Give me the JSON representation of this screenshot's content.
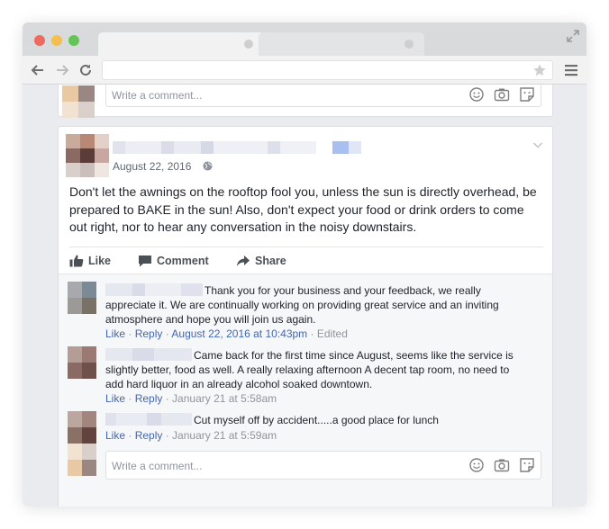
{
  "colors": {
    "link": "#4267b2",
    "meta": "#90949c",
    "text": "#1d2129",
    "page_bg": "#e9ebee"
  },
  "top_card": {
    "comment_placeholder": "Write a comment..."
  },
  "post": {
    "date": "August 22, 2016",
    "body": "Don't let the awnings on the rooftop fool you, unless the sun is directly overhead, be prepared to BAKE in the sun! Also, don't expect your food or drink orders to come out right, nor to hear any conversation in the noisy downstairs.",
    "actions": {
      "like": "Like",
      "comment": "Comment",
      "share": "Share"
    }
  },
  "comments": [
    {
      "text": "Thank you for your business and your feedback, we really appreciate it. We are continually working on providing great service and an inviting atmosphere and hope you will join us again.",
      "like": "Like",
      "reply": "Reply",
      "time": "August 22, 2016 at 10:43pm",
      "edited": "Edited"
    },
    {
      "text": "Came back for the first time since August, seems like the service is slightly better, food as well. A really relaxing afternoon A decent tap room, no need to add hard liquor in an already alcohol soaked downtown.",
      "like": "Like",
      "reply": "Reply",
      "time": "January 21 at 5:58am"
    },
    {
      "text": "Cut myself off by accident.....a good place for lunch",
      "like": "Like",
      "reply": "Reply",
      "time": "January 21 at 5:59am"
    }
  ],
  "bottom_comment": {
    "placeholder": "Write a comment..."
  },
  "separators": {
    "dot": " · "
  }
}
